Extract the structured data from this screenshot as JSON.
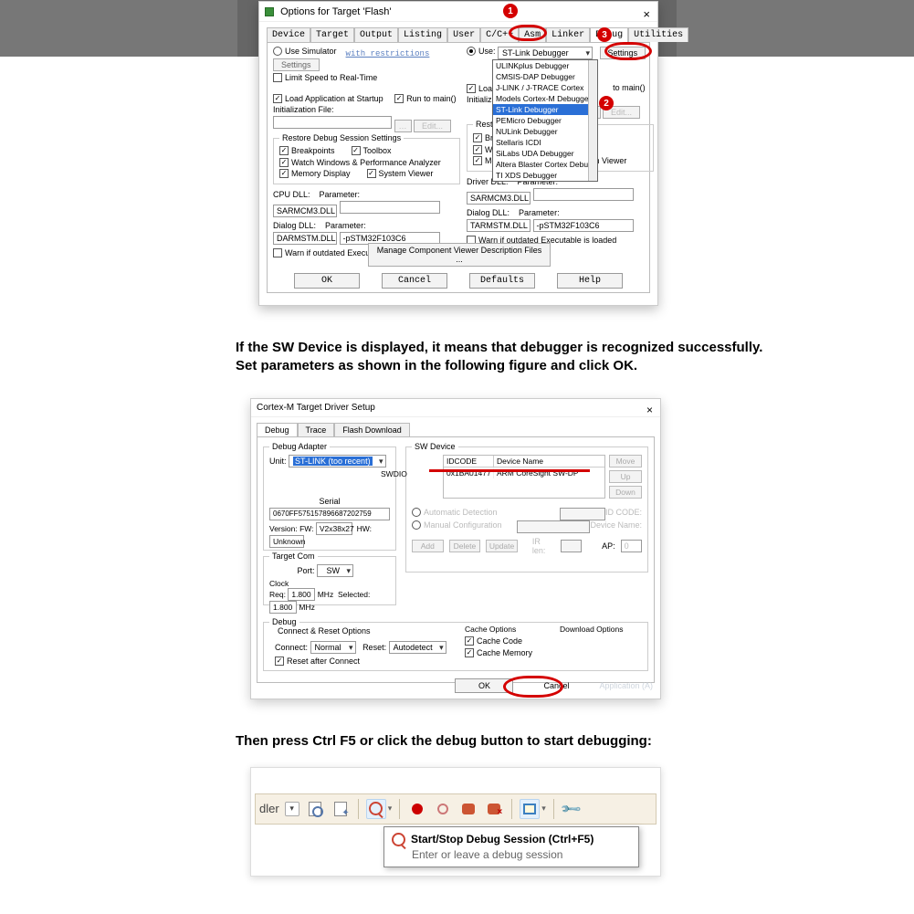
{
  "dialog1": {
    "title": "Options for Target 'Flash'",
    "tabs": [
      "Device",
      "Target",
      "Output",
      "Listing",
      "User",
      "C/C++",
      "Asm",
      "Linker",
      "Debug",
      "Utilities"
    ],
    "active_tab": "Debug",
    "left": {
      "use_simulator": "Use Simulator",
      "restrictions": "with restrictions",
      "settings": "Settings",
      "limit_speed": "Limit Speed to Real-Time",
      "load_startup": "Load Application at Startup",
      "run_to_main": "Run to main()",
      "init_file": "Initialization File:",
      "edit": "Edit...",
      "restore_title": "Restore Debug Session Settings",
      "breakpoints": "Breakpoints",
      "toolbox": "Toolbox",
      "watch": "Watch Windows & Performance Analyzer",
      "mem_display": "Memory Display",
      "sys_viewer": "System Viewer",
      "cpu_dll_lbl": "CPU DLL:",
      "param_lbl": "Parameter:",
      "cpu_dll": "SARMCM3.DLL",
      "dlg_dll_lbl": "Dialog DLL:",
      "dlg_dll": "DARMSTM.DLL",
      "dlg_param": "-pSTM32F103C6",
      "warn_outdated": "Warn if outdated Executable is loaded"
    },
    "right": {
      "use_lbl": "Use:",
      "debugger_selected": "ST-Link Debugger",
      "settings": "Settings",
      "load_lbl": "Load",
      "to_main": "to main()",
      "init_file": "Initializa",
      "edit": "Edit...",
      "restore_title": "Restore",
      "bp": "Br",
      "watch": "Watch Windows",
      "mem_display": "Memory Display",
      "sys_viewer": "System Viewer",
      "drv_dll_lbl": "Driver DLL:",
      "param_lbl": "Parameter:",
      "drv_dll": "SARMCM3.DLL",
      "dlg_dll_lbl": "Dialog DLL:",
      "dlg_dll": "TARMSTM.DLL",
      "dlg_param": "-pSTM32F103C6",
      "warn_outdated": "Warn if outdated Executable is loaded"
    },
    "debugger_options": [
      "ULINKplus Debugger",
      "CMSIS-DAP Debugger",
      "J-LINK / J-TRACE Cortex",
      "Models Cortex-M Debugger",
      "ST-Link Debugger",
      "PEMicro Debugger",
      "NULink Debugger",
      "Stellaris ICDI",
      "SiLabs UDA Debugger",
      "Altera Blaster Cortex Debugger",
      "TI XDS Debugger"
    ],
    "manage_btn": "Manage Component Viewer Description Files ...",
    "buttons": {
      "ok": "OK",
      "cancel": "Cancel",
      "defaults": "Defaults",
      "help": "Help"
    },
    "badges": {
      "1": "1",
      "2": "2",
      "3": "3"
    }
  },
  "instr1a": "If the SW Device is displayed, it means that debugger is recognized successfully.",
  "instr1b": "Set parameters as shown in the following figure and click OK.",
  "dialog2": {
    "title": "Cortex-M Target Driver Setup",
    "tabs": [
      "Debug",
      "Trace",
      "Flash Download"
    ],
    "active_tab": "Debug",
    "adapter": {
      "title": "Debug Adapter",
      "unit_lbl": "Unit:",
      "unit_val": "ST-LINK (too recent)",
      "serial_lbl": "Serial",
      "serial_val": "0670FF575157896687202759",
      "ver_lbl": "Version: FW:",
      "ver_val": "V2x38x27",
      "hw_lbl": "HW:",
      "hw_val": "Unknown"
    },
    "target_com": {
      "title": "Target Com",
      "port_lbl": "Port:",
      "port_val": "SW",
      "clock_lbl": "Clock",
      "req_lbl": "Req:",
      "req_val": "1.800",
      "mhz": "MHz",
      "sel_lbl": "Selected:",
      "sel_val": "1.800"
    },
    "sw_device": {
      "title": "SW Device",
      "hdr_id": "IDCODE",
      "hdr_name": "Device Name",
      "row_lbl": "SWDIO",
      "idcode": "0x1BA01477",
      "name": "ARM CoreSight SW-DP",
      "move": "Move",
      "up": "Up",
      "down": "Down",
      "auto": "Automatic Detection",
      "manual": "Manual Configuration",
      "idcode_lbl": "ID CODE:",
      "devname_lbl": "Device Name:",
      "add": "Add",
      "delete": "Delete",
      "update": "Update",
      "irlen_lbl": "IR len:",
      "ap_lbl": "AP:",
      "ap_val": "0"
    },
    "debug_group": {
      "title": "Debug",
      "cr_title": "Connect & Reset Options",
      "connect_lbl": "Connect:",
      "connect_val": "Normal",
      "reset_lbl": "Reset:",
      "reset_val": "Autodetect",
      "reset_after": "Reset after Connect",
      "cache_title": "Cache Options",
      "cache_code": "Cache Code",
      "cache_mem": "Cache Memory",
      "dl_title": "Download Options"
    },
    "buttons": {
      "ok": "OK",
      "cancel": "Cancel"
    },
    "appl": "Application (A)"
  },
  "instr2": "Then press Ctrl F5 or click the debug button to start debugging:",
  "toolbar": {
    "text": "dler",
    "tooltip_title": "Start/Stop Debug Session (Ctrl+F5)",
    "tooltip_sub": "Enter or leave a debug session"
  }
}
